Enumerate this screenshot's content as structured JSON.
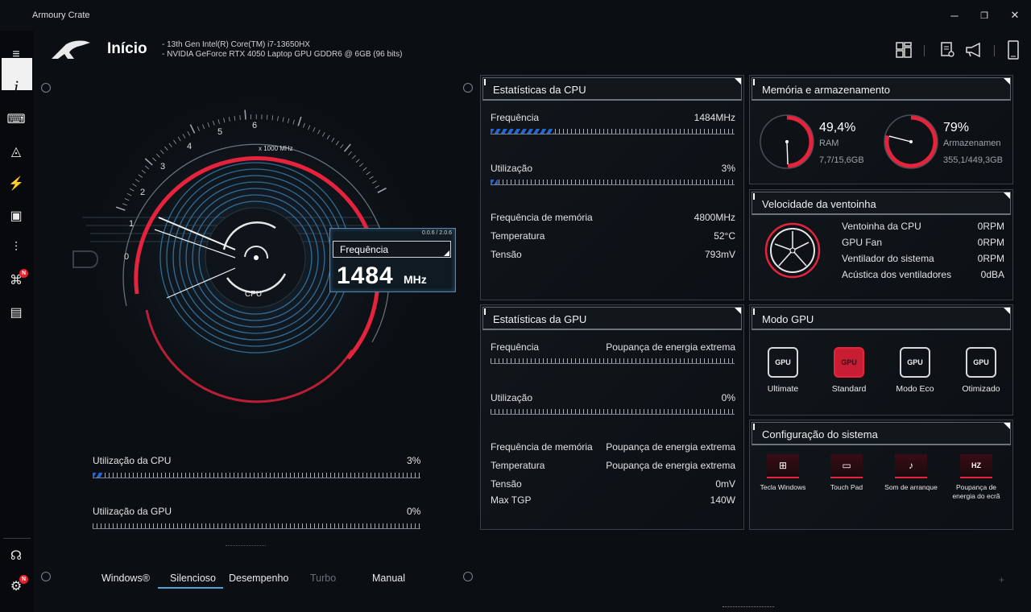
{
  "app": {
    "title": "Armoury Crate",
    "window_controls": {
      "minimize": "─",
      "maximize": "❐",
      "close": "✕"
    }
  },
  "sidebar": {
    "items": [
      {
        "name": "menu-icon",
        "glyph": "≡"
      },
      {
        "name": "info-icon",
        "glyph": "i"
      },
      {
        "name": "keyboard-icon",
        "glyph": "⌨"
      },
      {
        "name": "aura-icon",
        "glyph": "◬"
      },
      {
        "name": "scenario-icon",
        "glyph": "⚡"
      },
      {
        "name": "game-library-icon",
        "glyph": "▣"
      },
      {
        "name": "tuning-icon",
        "glyph": "⫶"
      },
      {
        "name": "deals-icon",
        "glyph": "⌘",
        "badge": "N"
      },
      {
        "name": "news-icon",
        "glyph": "▤"
      }
    ],
    "bottom": [
      {
        "name": "user-icon",
        "glyph": "☊"
      },
      {
        "name": "settings-icon",
        "glyph": "⚙",
        "badge": "N"
      }
    ]
  },
  "header": {
    "title": "Início",
    "cpu": "-  13th Gen Intel(R) Core(TM) i7-13650HX",
    "gpu": "-  NVIDIA GeForce RTX 4050 Laptop GPU GDDR6 @ 6GB (96 bits)",
    "icons": [
      "layout-icon",
      "document-icon",
      "megaphone-icon",
      "device-icon"
    ]
  },
  "gauge": {
    "ticks": [
      "0",
      "1",
      "2",
      "3",
      "4",
      "5",
      "6"
    ],
    "unit": "x 1000 MHz",
    "center_label": "CPU",
    "readout_label": "Frequência",
    "readout_value": "1484",
    "readout_unit": "MHz",
    "readout_range": "0.0.6 / 2.0.6",
    "value_fraction": 0.247
  },
  "utilization": {
    "cpu_label": "Utilização da CPU",
    "cpu_value": "3%",
    "cpu_fraction": 0.03,
    "gpu_label": "Utilização da GPU",
    "gpu_value": "0%",
    "gpu_fraction": 0.0
  },
  "modes": {
    "tabs": [
      "Windows®",
      "Silencioso",
      "Desempenho",
      "Turbo",
      "Manual"
    ],
    "active": "Silencioso"
  },
  "cpu_stats": {
    "title": "Estatísticas da CPU",
    "freq_label": "Frequência",
    "freq_value": "1484MHz",
    "freq_fraction": 0.26,
    "util_label": "Utilização",
    "util_value": "3%",
    "util_fraction": 0.03,
    "rows": [
      {
        "label": "Frequência de memória",
        "value": "4800MHz"
      },
      {
        "label": "Temperatura",
        "value": "52°C"
      },
      {
        "label": "Tensão",
        "value": "793mV"
      }
    ]
  },
  "gpu_stats": {
    "title": "Estatísticas da GPU",
    "freq_label": "Frequência",
    "freq_value": "Poupança de energia extrema",
    "util_label": "Utilização",
    "util_value": "0%",
    "rows": [
      {
        "label": "Frequência de memória",
        "value": "Poupança de energia extrema"
      },
      {
        "label": "Temperatura",
        "value": "Poupança de energia extrema"
      },
      {
        "label": "Tensão",
        "value": "0mV"
      },
      {
        "label": "Max TGP",
        "value": "140W"
      }
    ]
  },
  "memory": {
    "title": "Memória e armazenamento",
    "ram_percent": "49,4%",
    "ram_label": "RAM",
    "ram_detail": "7,7/15,6GB",
    "ram_fraction": 0.494,
    "storage_percent": "79%",
    "storage_label": "Armazenamen",
    "storage_detail": "355,1/449,3GB",
    "storage_fraction": 0.79
  },
  "fans": {
    "title": "Velocidade da ventoinha",
    "rows": [
      {
        "label": "Ventoinha da CPU",
        "value": "0RPM"
      },
      {
        "label": "GPU Fan",
        "value": "0RPM"
      },
      {
        "label": "Ventilador do sistema",
        "value": "0RPM"
      },
      {
        "label": "Acústica dos ventiladores",
        "value": "0dBA"
      }
    ]
  },
  "gpu_mode": {
    "title": "Modo GPU",
    "options": [
      {
        "label": "Ultimate",
        "icon": "GPU",
        "active": false
      },
      {
        "label": "Standard",
        "icon": "GPU",
        "active": true
      },
      {
        "label": "Modo Eco",
        "icon": "GPU",
        "active": false
      },
      {
        "label": "Otimizado",
        "icon": "GPU",
        "active": false
      }
    ]
  },
  "system_config": {
    "title": "Configuração do sistema",
    "items": [
      {
        "label": "Tecla Windows",
        "glyph": "⊞"
      },
      {
        "label": "Touch Pad",
        "glyph": "▭"
      },
      {
        "label": "Som de arranque",
        "glyph": "♪"
      },
      {
        "label": "Poupança de energia do ecrã",
        "glyph": "HZ"
      }
    ]
  },
  "colors": {
    "accent": "#e5233c",
    "blue": "#2a7cff",
    "panel_border": "#3a3f46"
  }
}
